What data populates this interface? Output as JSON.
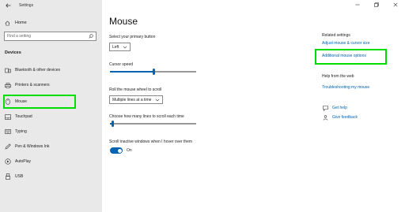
{
  "window": {
    "title": "Settings"
  },
  "nav": {
    "home_label": "Home",
    "search_placeholder": "Find a setting",
    "section_title": "Devices",
    "items": [
      {
        "label": "Bluetooth & other devices",
        "icon": "bluetooth-devices-icon"
      },
      {
        "label": "Printers & scanners",
        "icon": "printer-icon"
      },
      {
        "label": "Mouse",
        "icon": "mouse-icon",
        "selected": true
      },
      {
        "label": "Touchpad",
        "icon": "touchpad-icon"
      },
      {
        "label": "Typing",
        "icon": "keyboard-icon"
      },
      {
        "label": "Pen & Windows Ink",
        "icon": "pen-icon"
      },
      {
        "label": "AutoPlay",
        "icon": "autoplay-icon"
      },
      {
        "label": "USB",
        "icon": "usb-icon"
      }
    ]
  },
  "main": {
    "title": "Mouse",
    "primary_button": {
      "label": "Select your primary button",
      "value": "Left"
    },
    "cursor_speed": {
      "label": "Cursor speed",
      "level": 0.5
    },
    "scroll_wheel": {
      "label": "Roll the mouse wheel to scroll",
      "value": "Multiple lines at a time"
    },
    "lines_to_scroll": {
      "label": "Choose how many lines to scroll each time",
      "level": 0.03
    },
    "scroll_inactive": {
      "label": "Scroll inactive windows when I hover over them",
      "state": "On"
    }
  },
  "related": {
    "heading": "Related settings",
    "links": [
      "Adjust mouse & cursor size",
      "Additional mouse options"
    ],
    "help_heading": "Help from the web",
    "help_link": "Troubleshooting my mouse",
    "get_help": "Get help",
    "give_feedback": "Give feedback"
  },
  "colors": {
    "accent": "#0063b1",
    "highlight": "#00dd00",
    "nav_bg": "#e9e9e9"
  }
}
